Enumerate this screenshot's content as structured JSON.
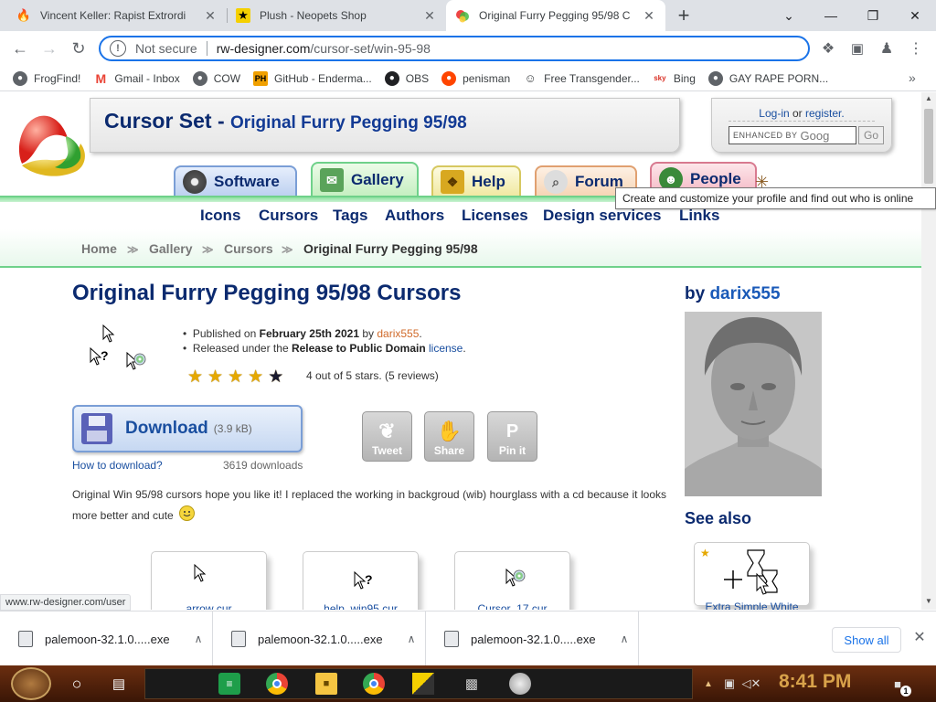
{
  "browser": {
    "tabs": [
      {
        "title": "Vincent Keller: Rapist Extrordi",
        "icon": "flame-icon",
        "active": false
      },
      {
        "title": "Plush - Neopets Shop",
        "icon": "star-icon",
        "active": false
      },
      {
        "title": "Original Furry Pegging 95/98 C",
        "icon": "rw-designer-icon",
        "active": true
      }
    ],
    "new_tab": "+",
    "security_label": "Not secure",
    "url_domain": "rw-designer.com",
    "url_path": "/cursor-set/win-95-98",
    "bookmarks": [
      {
        "label": "FrogFind!",
        "icon": "globe-icon",
        "color": "#5f6368"
      },
      {
        "label": "Gmail - Inbox",
        "icon": "gmail-icon",
        "color": "#ea4335"
      },
      {
        "label": "COW",
        "icon": "globe-icon",
        "color": "#5f6368"
      },
      {
        "label": "GitHub - Enderma...",
        "icon": "ph-icon",
        "color": "#f0a000"
      },
      {
        "label": "OBS",
        "icon": "github-icon",
        "color": "#202124"
      },
      {
        "label": "penisman",
        "icon": "reddit-icon",
        "color": "#ff4500"
      },
      {
        "label": "Free Transgender...",
        "icon": "mask-icon",
        "color": "#5f6368"
      },
      {
        "label": "Bing",
        "icon": "sky-icon",
        "color": "#d93025"
      },
      {
        "label": "GAY RAPE PORN...",
        "icon": "globe-icon",
        "color": "#5f6368"
      }
    ],
    "bookmarks_overflow": "»"
  },
  "site": {
    "title": "Cursor Set - ",
    "subtitle": "Original Furry Pegging 95/98",
    "login": "Log-in",
    "or": " or ",
    "register": "register.",
    "search_placeholder": "ENHANCED BY",
    "search_brand": "Goog",
    "go": "Go",
    "tabs": [
      "Software",
      "Gallery",
      "Help",
      "Forum",
      "People"
    ],
    "subnav": [
      "Icons",
      "Cursors",
      "Tags",
      "Authors",
      "Licenses",
      "Design services",
      "Links"
    ],
    "breadcrumb": [
      "Home",
      "Gallery",
      "Cursors",
      "Original Furry Pegging 95/98"
    ],
    "tooltip": "Create and customize your profile and find out who is online"
  },
  "content": {
    "heading": "Original Furry Pegging 95/98 Cursors",
    "by": "by ",
    "author": "darix555",
    "published_prefix": "Published on ",
    "published_date": "February 25th 2021",
    "published_by": " by ",
    "released_prefix": "Released under the ",
    "license_name": "Release to Public Domain",
    "license_word": " license",
    "rating": 4,
    "rating_max": 5,
    "rating_text": "4 out of 5 stars. (5 reviews)",
    "download_label": "Download",
    "download_size": "(3.9 kB)",
    "how_to": "How to download?",
    "downloads": "3619 downloads",
    "share": [
      "Tweet",
      "Share",
      "Pin it"
    ],
    "description": "Original Win 95/98 cursors hope you like it! I replaced the working in backgroud (wib) hourglass with a cd because it looks more better and cute",
    "see_also": "See also",
    "cards": [
      "arrow cur",
      "help_win95 cur",
      "Cursor_17 cur"
    ],
    "see_also_card": "Extra Simple White"
  },
  "status_url": "www.rw-designer.com/user",
  "downloads_shelf": {
    "items": [
      "palemoon-32.1.0.....exe",
      "palemoon-32.1.0.....exe",
      "palemoon-32.1.0.....exe"
    ],
    "show_all": "Show all"
  },
  "taskbar": {
    "clock": "8:41 PM",
    "notification_count": "1"
  }
}
